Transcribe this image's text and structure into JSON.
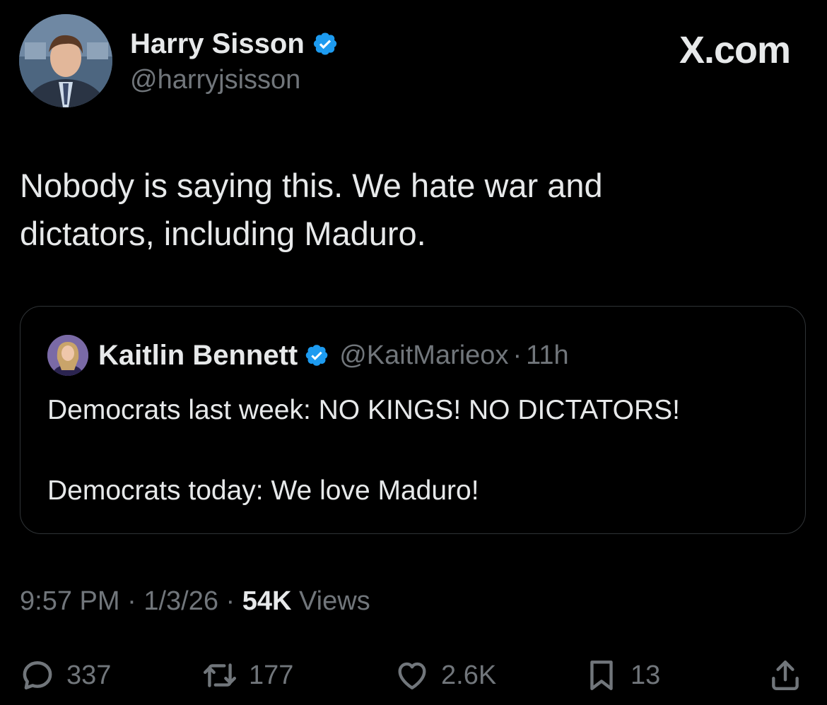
{
  "brand": {
    "label": "X.com"
  },
  "author": {
    "display_name": "Harry Sisson",
    "handle": "@harryjsisson",
    "verified": true
  },
  "tweet": {
    "text": "Nobody is saying this. We hate war and\ndictators, including Maduro."
  },
  "quote": {
    "display_name": "Kaitlin Bennett",
    "handle": "@KaitMarieox",
    "separator": "·",
    "time": "11h",
    "verified": true,
    "text": "Democrats last week: NO KINGS! NO DICTATORS!\n\nDemocrats today: We love Maduro!"
  },
  "meta": {
    "time": "9:57 PM",
    "sep1": " · ",
    "date": "1/3/26",
    "sep2": " · ",
    "views_count": "54K",
    "views_label": " Views"
  },
  "actions": {
    "reply": {
      "icon": "reply-icon",
      "count": "337"
    },
    "repost": {
      "icon": "repost-icon",
      "count": "177"
    },
    "like": {
      "icon": "heart-icon",
      "count": "2.6K"
    },
    "bookmark": {
      "icon": "bookmark-icon",
      "count": "13"
    },
    "share": {
      "icon": "share-icon"
    }
  },
  "colors": {
    "background": "#000000",
    "primary_text": "#e7e9ea",
    "secondary_text": "#71767b",
    "verified_blue": "#1d9bf0",
    "border": "#2f3336"
  }
}
